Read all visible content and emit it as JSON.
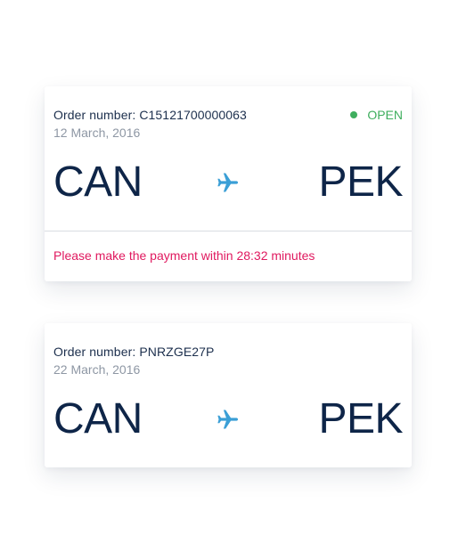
{
  "orders": [
    {
      "order_label": "Order number: C15121700000063",
      "date": "12 March, 2016",
      "status": "OPEN",
      "from": "CAN",
      "to": "PEK",
      "payment_note": "Please make the payment within 28:32 minutes"
    },
    {
      "order_label": "Order number: PNRZGE27P",
      "date": "22 March, 2016",
      "from": "CAN",
      "to": "PEK"
    }
  ],
  "icons": {
    "flight": "airplane-icon",
    "status": "status-dot-icon"
  },
  "colors": {
    "primary_text": "#0e2548",
    "secondary_text": "#8e97a4",
    "status_open": "#3fae5e",
    "alert": "#e0195f",
    "plane": "#3b9fd6"
  }
}
